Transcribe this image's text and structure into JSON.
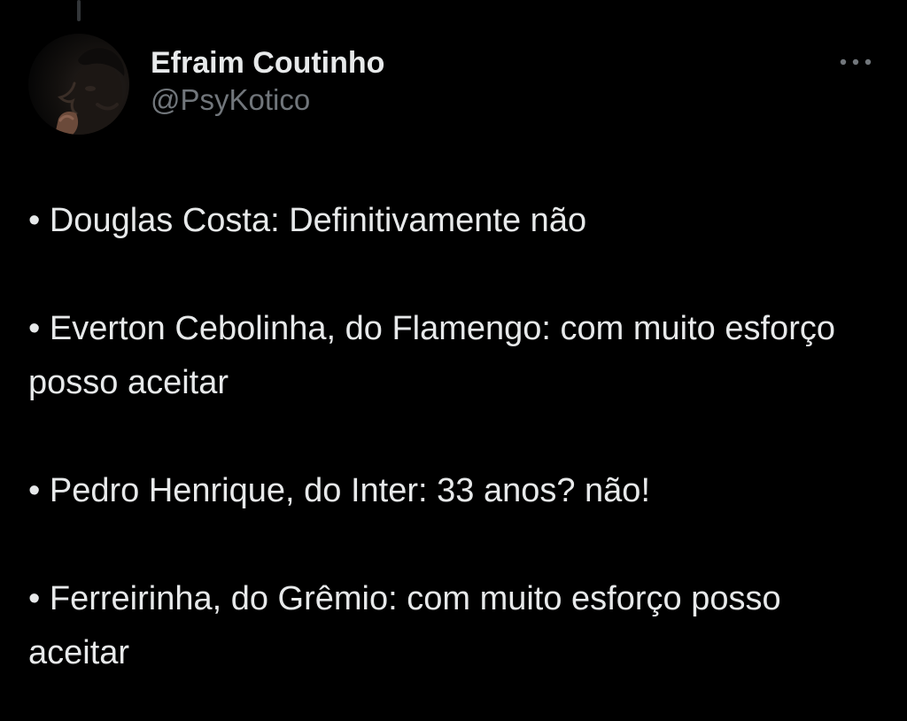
{
  "tweet": {
    "author": {
      "display_name": "Efraim Coutinho",
      "handle": "@PsyKotico",
      "avatar": "avatar"
    },
    "more_icon": "more-horizontal-icon",
    "paragraphs": [
      "• Douglas Costa: Definitivamente não",
      "• Everton Cebolinha, do Flamengo: com muito esforço posso aceitar",
      "• Pedro Henrique, do Inter: 33 anos? não!",
      "• Ferreirinha, do Grêmio: com muito esforço posso aceitar"
    ]
  },
  "colors": {
    "background": "#000000",
    "text_primary": "#e7e9ea",
    "text_secondary": "#71767b",
    "thread_line": "#333639"
  }
}
